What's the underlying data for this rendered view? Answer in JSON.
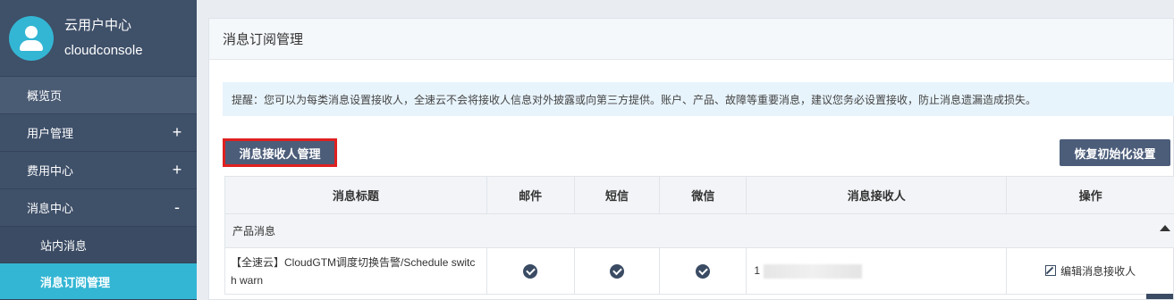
{
  "profile": {
    "name": "云用户中心",
    "sub": "cloudconsole"
  },
  "nav": {
    "overview": "概览页",
    "user_mgmt": "用户管理",
    "billing": "费用中心",
    "messages": "消息中心",
    "expand_symbol": "+",
    "collapse_symbol": "-",
    "sub_inbox": "站内消息",
    "sub_subscription": "消息订阅管理"
  },
  "panel": {
    "title": "消息订阅管理",
    "notice": "提醒：您可以为每类消息设置接收人，全速云不会将接收人信息对外披露或向第三方提供。账户、产品、故障等重要消息，建议您务必设置接收，防止消息遗漏造成损失。",
    "manage_button": "消息接收人管理",
    "reset_button": "恢复初始化设置"
  },
  "table": {
    "headers": [
      "消息标题",
      "邮件",
      "短信",
      "微信",
      "消息接收人",
      "操作"
    ],
    "group_label": "产品消息",
    "rows": [
      {
        "title": "【全速云】CloudGTM调度切换告警/Schedule switch warn",
        "email_checked": true,
        "sms_checked": true,
        "wechat_checked": true,
        "receiver_prefix": "1",
        "action": "编辑消息接收人"
      }
    ]
  },
  "colors": {
    "sidebar": "#3a4b63",
    "accent": "#33b6d4",
    "button": "#4c5d7a",
    "highlight_border": "#e02020"
  }
}
